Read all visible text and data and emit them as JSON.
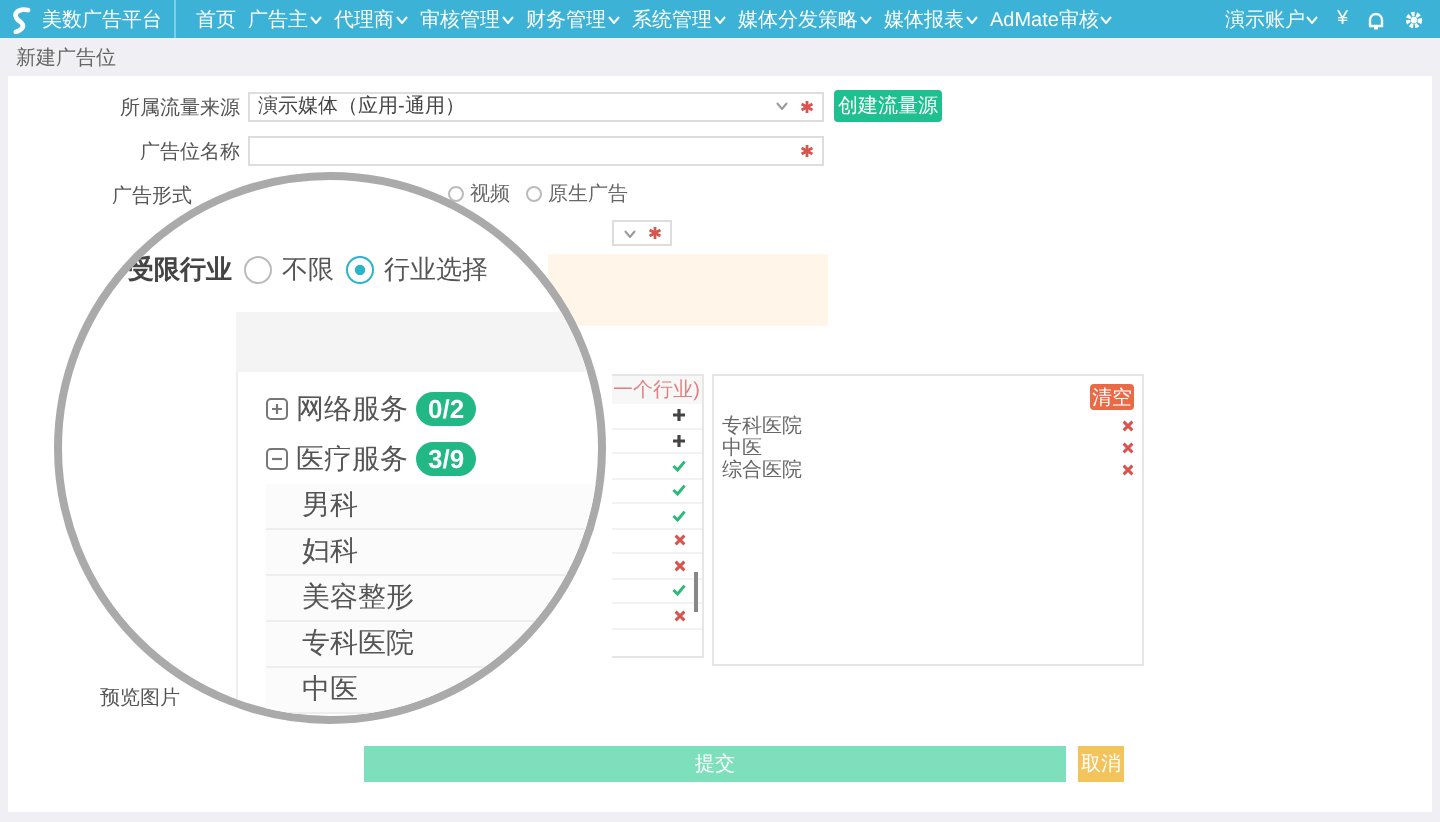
{
  "nav": {
    "logo": "美数广告平台",
    "items": [
      {
        "label": "首页",
        "dropdown": false
      },
      {
        "label": "广告主",
        "dropdown": true
      },
      {
        "label": "代理商",
        "dropdown": true
      },
      {
        "label": "审核管理",
        "dropdown": true
      },
      {
        "label": "财务管理",
        "dropdown": true
      },
      {
        "label": "系统管理",
        "dropdown": true
      },
      {
        "label": "媒体分发策略",
        "dropdown": true
      },
      {
        "label": "媒体报表",
        "dropdown": true
      },
      {
        "label": "AdMate审核",
        "dropdown": true
      }
    ],
    "account": "演示账户",
    "currency": "¥"
  },
  "breadcrumb": "新建广告位",
  "form": {
    "traffic_source": {
      "label": "所属流量来源",
      "value": "演示媒体（应用-通用）",
      "required": true
    },
    "create_button": "创建流量源",
    "slot_name": {
      "label": "广告位名称",
      "required": true
    },
    "ad_type": {
      "label": "广告形式",
      "options": [
        {
          "label": "视频",
          "selected": false
        },
        {
          "label": "原生广告",
          "selected": false
        }
      ]
    },
    "size_select": {
      "required": true
    },
    "industry_list": {
      "header_note": "一个行业)",
      "rows": [
        {
          "kind": "add"
        },
        {
          "kind": "add"
        },
        {
          "kind": "included"
        },
        {
          "kind": "included"
        },
        {
          "kind": "included"
        },
        {
          "kind": "excluded"
        },
        {
          "kind": "excluded"
        },
        {
          "kind": "included"
        },
        {
          "kind": "excluded"
        }
      ]
    },
    "chosen_panel": {
      "clear_button": "清空",
      "items": [
        {
          "label": "专科医院"
        },
        {
          "label": "中医"
        },
        {
          "label": "综合医院"
        }
      ]
    },
    "preview_label": "预览图片",
    "submit_button": "提交",
    "cancel_button": "取消"
  },
  "magnifier": {
    "restriction": {
      "label": "受限行业",
      "options": [
        {
          "label": "不限",
          "selected": false
        },
        {
          "label": "行业选择",
          "selected": true
        }
      ]
    },
    "tree": [
      {
        "label": "网络服务",
        "count": "0/2",
        "expanded": false
      },
      {
        "label": "医疗服务",
        "count": "3/9",
        "expanded": true,
        "children": [
          {
            "label": "男科"
          },
          {
            "label": "妇科"
          },
          {
            "label": "美容整形"
          },
          {
            "label": "专科医院"
          },
          {
            "label": "中医"
          }
        ]
      }
    ]
  }
}
